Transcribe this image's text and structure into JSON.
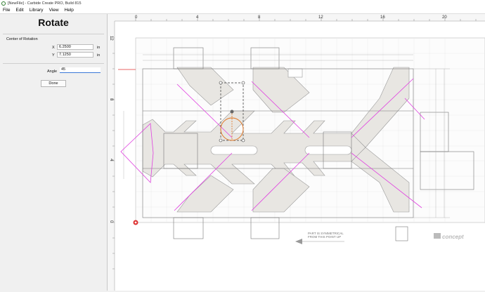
{
  "window": {
    "title": "[NewFile] - Carbide Create PRO, Build 815"
  },
  "menu": {
    "items": [
      "File",
      "Edit",
      "Library",
      "View",
      "Help"
    ]
  },
  "panel": {
    "title": "Rotate",
    "center_label": "Center of Rotation",
    "x_label": "X",
    "x_value": "6.2500",
    "x_unit": "in",
    "y_label": "Y",
    "y_value": "7.1250",
    "y_unit": "in",
    "angle_label": "Angle",
    "angle_value": "45",
    "done_label": "Done"
  },
  "ruler": {
    "top_ticks": [
      "0",
      "4",
      "8",
      "12",
      "16",
      "20"
    ],
    "left_ticks": [
      "12",
      "8",
      "4",
      "0"
    ]
  },
  "drawing": {
    "note_line1": "PART IS SYMMETRICAL",
    "note_line2": "FROM THIS POINT UP",
    "logo_text": "concept"
  },
  "colors": {
    "accent": "#3a78d8",
    "selection": "#e0701a",
    "vector": "#e040e0",
    "part_fill": "#e8e6e2"
  }
}
